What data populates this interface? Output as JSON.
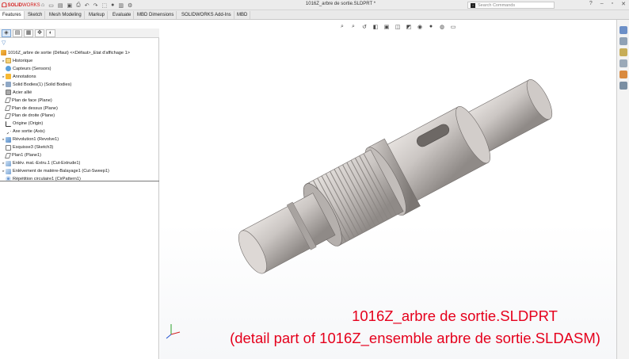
{
  "app": {
    "brand_bold": "SOLID",
    "brand_thin": "WORKS",
    "document_title": "1016Z_arbre de sortie.SLDPRT *"
  },
  "search": {
    "placeholder": "Search Commands"
  },
  "tabs": [
    "Features",
    "Sketch",
    "Mesh Modeling",
    "Markup",
    "Evaluate",
    "MBD Dimensions",
    "SOLIDWORKS Add-Ins",
    "MBD"
  ],
  "tree": {
    "root": "1016Z_arbre de sortie (Défaut) <<Défaut>_Etat d'affichage 1>",
    "items": [
      {
        "label": "Historique",
        "icon": "folder-icon",
        "expandable": true
      },
      {
        "label": "Capteurs (Sensors)",
        "icon": "sensor-icon",
        "expandable": false
      },
      {
        "label": "Annotations",
        "icon": "annotation-icon",
        "expandable": true
      },
      {
        "label": "Solid Bodies(1) (Solid Bodies)",
        "icon": "solid-bodies-icon",
        "expandable": true
      },
      {
        "label": "Acier allié",
        "icon": "material-icon",
        "expandable": false
      },
      {
        "label": "Plan de face (Plane)",
        "icon": "plane-icon",
        "expandable": false
      },
      {
        "label": "Plan de dessus (Plane)",
        "icon": "plane-icon",
        "expandable": false
      },
      {
        "label": "Plan de droite (Plane)",
        "icon": "plane-icon",
        "expandable": false
      },
      {
        "label": "Origine (Origin)",
        "icon": "origin-icon",
        "expandable": false
      },
      {
        "label": "Axe sortie (Axis)",
        "icon": "axis-icon",
        "expandable": false
      },
      {
        "label": "Révolution1 (Revolve1)",
        "icon": "revolve-icon",
        "expandable": true
      },
      {
        "label": "Esquisse3 (Sketch3)",
        "icon": "sketch-icon",
        "expandable": false
      },
      {
        "label": "Plan1 (Plane1)",
        "icon": "plane-icon",
        "expandable": false
      },
      {
        "label": "Enlèv. mat.-Extru.1 (Cut-Extrude1)",
        "icon": "cut-extrude-icon",
        "expandable": true
      },
      {
        "label": "Enlèvement de matière-Balayage1 (Cut-Sweep1)",
        "icon": "cut-sweep-icon",
        "expandable": true
      },
      {
        "label": "Répétition circulaire1 (CirPattern1)",
        "icon": "circular-pattern-icon",
        "expandable": false
      }
    ]
  },
  "overlay": {
    "line1": "1016Z_arbre de sortie.SLDPRT",
    "line2": "(detail part of 1016Z_ensemble arbre de sortie.SLDASM)"
  },
  "colors": {
    "overlay_text": "#e5001c",
    "brand": "#d6201f",
    "part_metal": "#c9c4c1"
  }
}
